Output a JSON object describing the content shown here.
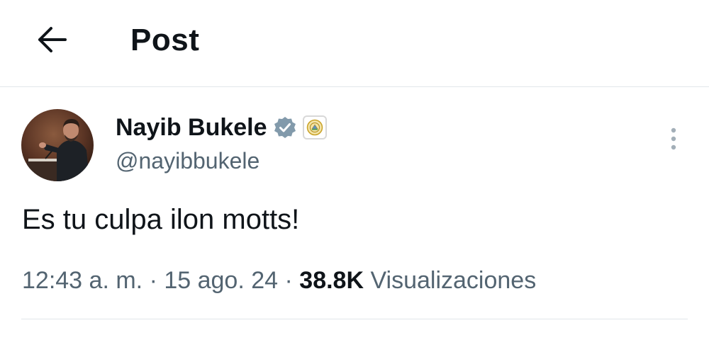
{
  "header": {
    "back_icon": "arrow-left-icon",
    "title": "Post"
  },
  "post": {
    "author": {
      "display_name": "Nayib Bukele",
      "handle": "@nayibbukele",
      "verified_badge_icon": "verified-check-icon",
      "verified_badge_color": "#829aab",
      "affiliate_badge_icon": "government-seal-icon",
      "affiliate_badge_color": "#c9a227"
    },
    "more_icon": "more-vertical-icon",
    "text": "Es tu culpa ilon motts!",
    "meta": {
      "time": "12:43 a. m.",
      "separator": "·",
      "date": "15 ago. 24",
      "views_count": "38.8K",
      "views_label": "Visualizaciones"
    }
  }
}
